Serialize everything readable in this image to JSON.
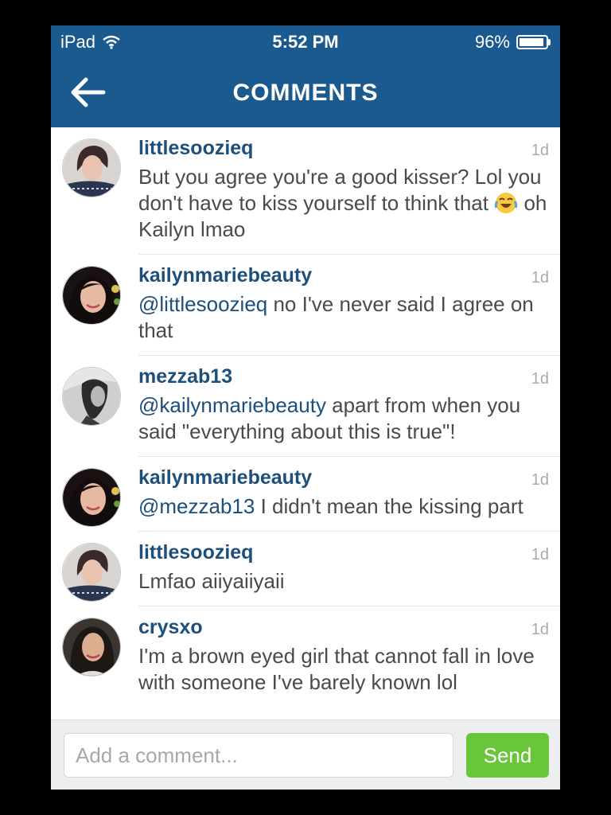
{
  "status_bar": {
    "carrier": "iPad",
    "time": "5:52 PM",
    "battery": "96%"
  },
  "header": {
    "title": "COMMENTS"
  },
  "comments": [
    {
      "username": "littlesoozieq",
      "time": "1d",
      "text_before": "But you agree you're a good kisser? Lol you don't have to kiss yourself to think that ",
      "emoji": "face-with-tears-of-joy-icon",
      "text_after": " oh Kailyn lmao"
    },
    {
      "username": "kailynmariebeauty",
      "time": "1d",
      "mention": "@littlesoozieq",
      "text": " no I've never said I agree on that"
    },
    {
      "username": "mezzab13",
      "time": "1d",
      "mention": "@kailynmariebeauty",
      "text": " apart from when you said \"everything about this is true\"!"
    },
    {
      "username": "kailynmariebeauty",
      "time": "1d",
      "mention": "@mezzab13",
      "text": " I didn't mean the kissing part"
    },
    {
      "username": "littlesoozieq",
      "time": "1d",
      "text": "Lmfao aiiyaiiyaii"
    },
    {
      "username": "crysxo",
      "time": "1d",
      "text": "I'm a brown eyed girl that cannot fall in love with someone I've barely known lol"
    }
  ],
  "composer": {
    "placeholder": "Add a comment...",
    "value": "",
    "send_label": "Send"
  },
  "colors": {
    "header": "#1a5a8e",
    "username": "#1d4f7a",
    "send": "#69c53a",
    "timestamp": "#aaaaaa"
  }
}
